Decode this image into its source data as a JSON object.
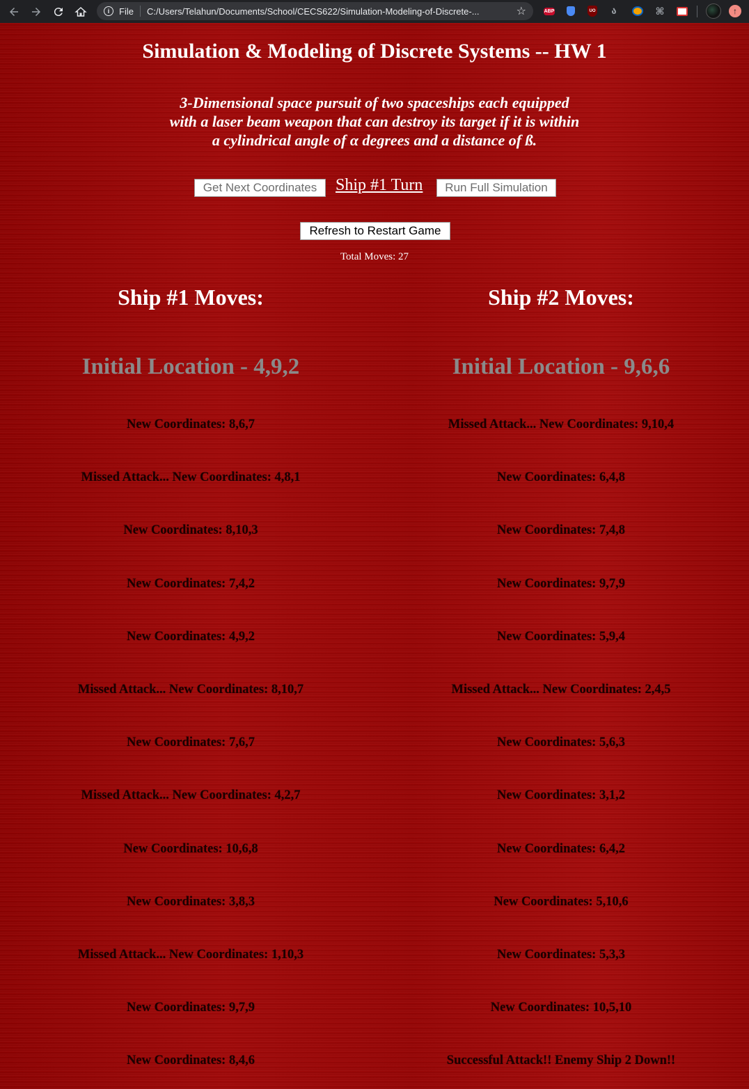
{
  "browser": {
    "scheme": "File",
    "url": "C:/Users/Telahun/Documents/School/CECS622/Simulation-Modeling-of-Discrete-...",
    "extensions": [
      "abp-icon",
      "shield-icon",
      "ublock-icon",
      "grammar-icon",
      "owl-icon",
      "pdf-icon",
      "mail-icon"
    ]
  },
  "page": {
    "title": "Simulation & Modeling of Discrete Systems -- HW 1",
    "description_line1": "3-Dimensional space pursuit of two spaceships each equipped",
    "description_line2": "with a laser beam weapon that can destroy its target if it is within",
    "description_line3": "a cylindrical angle of α degrees and a distance of ß.",
    "buttons": {
      "next": "Get Next Coordinates",
      "turn": "Ship #1 Turn",
      "run": "Run Full Simulation",
      "refresh": "Refresh to Restart Game"
    },
    "total_moves": "Total Moves: 27"
  },
  "ship1": {
    "heading": "Ship #1 Moves:",
    "initial": "Initial Location - 4,9,2",
    "moves": [
      "New Coordinates: 8,6,7",
      "Missed Attack... New Coordinates: 4,8,1",
      "New Coordinates: 8,10,3",
      "New Coordinates: 7,4,2",
      "New Coordinates: 4,9,2",
      "Missed Attack... New Coordinates: 8,10,7",
      "New Coordinates: 7,6,7",
      "Missed Attack... New Coordinates: 4,2,7",
      "New Coordinates: 10,6,8",
      "New Coordinates: 3,8,3",
      "Missed Attack... New Coordinates: 1,10,3",
      "New Coordinates: 9,7,9",
      "New Coordinates: 8,4,6"
    ]
  },
  "ship2": {
    "heading": "Ship #2 Moves:",
    "initial": "Initial Location - 9,6,6",
    "moves": [
      "Missed Attack... New Coordinates: 9,10,4",
      "New Coordinates: 6,4,8",
      "New Coordinates: 7,4,8",
      "New Coordinates: 9,7,9",
      "New Coordinates: 5,9,4",
      "Missed Attack... New Coordinates: 2,4,5",
      "New Coordinates: 5,6,3",
      "New Coordinates: 3,1,2",
      "New Coordinates: 6,4,2",
      "New Coordinates: 5,10,6",
      "New Coordinates: 5,3,3",
      "New Coordinates: 10,5,10",
      "Successful Attack!! Enemy Ship 2 Down!!"
    ]
  }
}
